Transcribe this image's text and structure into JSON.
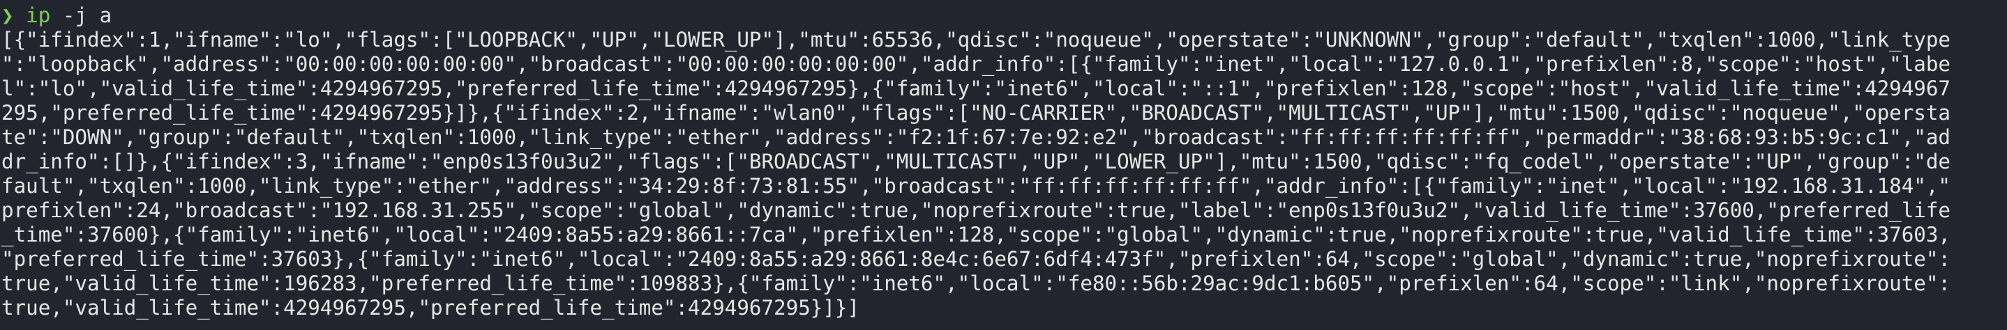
{
  "terminal": {
    "top_fragment": "                _                      _",
    "prompt": {
      "symbol": "❯",
      "command": "ip",
      "args": "-j a"
    },
    "output_lines": [
      "[{\"ifindex\":1,\"ifname\":\"lo\",\"flags\":[\"LOOPBACK\",\"UP\",\"LOWER_UP\"],\"mtu\":65536,\"qdisc\":\"noqueue\",\"operstate\":\"UNKNOWN\",\"group\":\"default\",\"txqlen\":1000,\"link_type",
      "\":\"loopback\",\"address\":\"00:00:00:00:00:00\",\"broadcast\":\"00:00:00:00:00:00\",\"addr_info\":[{\"family\":\"inet\",\"local\":\"127.0.0.1\",\"prefixlen\":8,\"scope\":\"host\",\"labe",
      "l\":\"lo\",\"valid_life_time\":4294967295,\"preferred_life_time\":4294967295},{\"family\":\"inet6\",\"local\":\"::1\",\"prefixlen\":128,\"scope\":\"host\",\"valid_life_time\":4294967",
      "295,\"preferred_life_time\":4294967295}]},{\"ifindex\":2,\"ifname\":\"wlan0\",\"flags\":[\"NO-CARRIER\",\"BROADCAST\",\"MULTICAST\",\"UP\"],\"mtu\":1500,\"qdisc\":\"noqueue\",\"opersta",
      "te\":\"DOWN\",\"group\":\"default\",\"txqlen\":1000,\"link_type\":\"ether\",\"address\":\"f2:1f:67:7e:92:e2\",\"broadcast\":\"ff:ff:ff:ff:ff:ff\",\"permaddr\":\"38:68:93:b5:9c:c1\",\"ad",
      "dr_info\":[]},{\"ifindex\":3,\"ifname\":\"enp0s13f0u3u2\",\"flags\":[\"BROADCAST\",\"MULTICAST\",\"UP\",\"LOWER_UP\"],\"mtu\":1500,\"qdisc\":\"fq_codel\",\"operstate\":\"UP\",\"group\":\"de",
      "fault\",\"txqlen\":1000,\"link_type\":\"ether\",\"address\":\"34:29:8f:73:81:55\",\"broadcast\":\"ff:ff:ff:ff:ff:ff\",\"addr_info\":[{\"family\":\"inet\",\"local\":\"192.168.31.184\",\"",
      "prefixlen\":24,\"broadcast\":\"192.168.31.255\",\"scope\":\"global\",\"dynamic\":true,\"noprefixroute\":true,\"label\":\"enp0s13f0u3u2\",\"valid_life_time\":37600,\"preferred_life",
      "_time\":37600},{\"family\":\"inet6\",\"local\":\"2409:8a55:a29:8661::7ca\",\"prefixlen\":128,\"scope\":\"global\",\"dynamic\":true,\"noprefixroute\":true,\"valid_life_time\":37603,",
      "\"preferred_life_time\":37603},{\"family\":\"inet6\",\"local\":\"2409:8a55:a29:8661:8e4c:6e67:6df4:473f\",\"prefixlen\":64,\"scope\":\"global\",\"dynamic\":true,\"noprefixroute\":",
      "true,\"valid_life_time\":196283,\"preferred_life_time\":109883},{\"family\":\"inet6\",\"local\":\"fe80::56b:29ac:9dc1:b605\",\"prefixlen\":64,\"scope\":\"link\",\"noprefixroute\":",
      "true,\"valid_life_time\":4294967295,\"preferred_life_time\":4294967295}]}]"
    ],
    "colors": {
      "background": "#23252e",
      "foreground": "#e6e6e6",
      "prompt_accent": "#7ccf59"
    }
  }
}
